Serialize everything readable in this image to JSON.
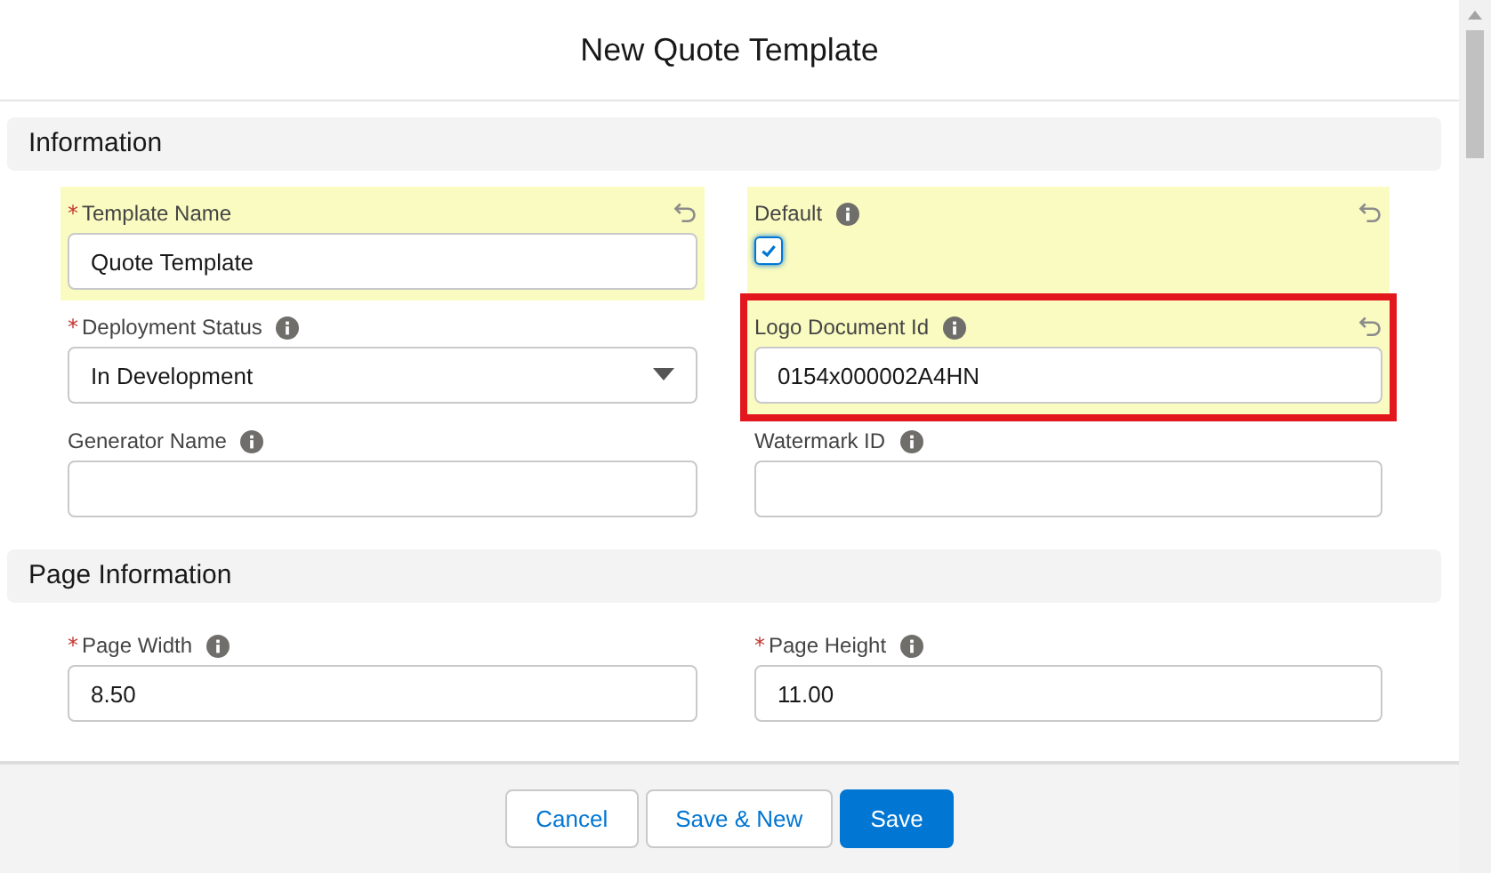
{
  "modal": {
    "title": "New Quote Template"
  },
  "sections": [
    {
      "title": "Information",
      "fields": [
        {
          "kind": "text",
          "label": "Template Name",
          "required_mark": "*",
          "info": false,
          "changed": true,
          "outlined": false,
          "value": "Quote Template"
        },
        {
          "kind": "checkbox",
          "label": "Default",
          "info": true,
          "changed": true,
          "outlined": false,
          "checked": true
        },
        {
          "kind": "picklist",
          "label": "Deployment Status",
          "required_mark": "*",
          "info": true,
          "changed": false,
          "outlined": false,
          "value": "In Development"
        },
        {
          "kind": "text",
          "label": "Logo Document Id",
          "info": true,
          "changed": true,
          "outlined": true,
          "value": "0154x000002A4HN"
        },
        {
          "kind": "text",
          "label": "Generator Name",
          "info": true,
          "changed": false,
          "outlined": false
        },
        {
          "kind": "text",
          "label": "Watermark ID",
          "info": true,
          "changed": false,
          "outlined": false
        }
      ]
    },
    {
      "title": "Page Information",
      "fields": [
        {
          "kind": "text",
          "label": "Page Width",
          "required_mark": "*",
          "info": true,
          "changed": false,
          "outlined": false,
          "value": "8.50"
        },
        {
          "kind": "text",
          "label": "Page Height",
          "required_mark": "*",
          "info": true,
          "changed": false,
          "outlined": false,
          "value": "11.00"
        }
      ]
    }
  ],
  "footer": {
    "buttons": [
      {
        "label": "Cancel",
        "kind": "neutral"
      },
      {
        "label": "Save & New",
        "kind": "neutral"
      },
      {
        "label": "Save",
        "kind": "brand"
      }
    ]
  }
}
